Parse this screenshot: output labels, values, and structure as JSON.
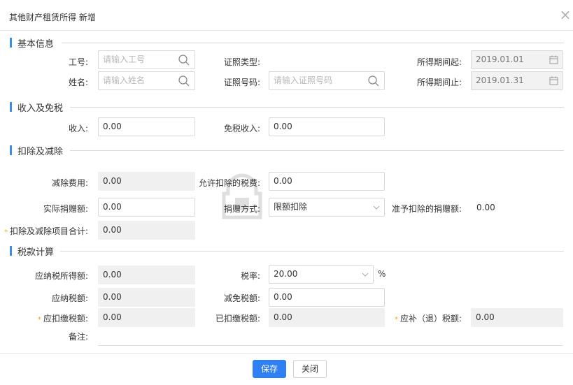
{
  "dialog": {
    "title": "其他财产租赁所得 新增",
    "close_glyph": "×"
  },
  "sections": {
    "basic": "基本信息",
    "income": "收入及免税",
    "deduction": "扣除及减除",
    "tax": "税款计算"
  },
  "basic": {
    "employee_id_label": "工号:",
    "employee_id_placeholder": "请输入工号",
    "id_type_label": "证照类型:",
    "period_start_label": "所得期间起:",
    "period_start_value": "2019.01.01",
    "name_label": "姓名:",
    "name_placeholder": "请输入姓名",
    "id_number_label": "证照号码:",
    "id_number_placeholder": "请输入证照号码",
    "period_end_label": "所得期间止:",
    "period_end_value": "2019.01.31"
  },
  "income": {
    "income_label": "收入:",
    "income_value": "0.00",
    "exempt_label": "免税收入:",
    "exempt_value": "0.00"
  },
  "deduction": {
    "reduce_fee_label": "减除费用:",
    "reduce_fee_value": "0.00",
    "allowed_tax_label": "允许扣除的税费:",
    "allowed_tax_value": "0.00",
    "donation_label": "实际捐赠额:",
    "donation_value": "0.00",
    "donation_method_label": "捐赠方式:",
    "donation_method_value": "限额扣除",
    "approved_donation_label": "准予扣除的捐赠额:",
    "approved_donation_value": "0.00",
    "total_label": "扣除及减除项目合计:",
    "total_value": "0.00"
  },
  "tax": {
    "taxable_income_label": "应纳税所得额:",
    "taxable_income_value": "0.00",
    "rate_label": "税率:",
    "rate_value": "20.00",
    "rate_unit": "%",
    "payable_label": "应纳税额:",
    "payable_value": "0.00",
    "relief_label": "减免税额:",
    "relief_value": "0.00",
    "withhold_label": "应扣缴税额:",
    "withhold_value": "0.00",
    "paid_label": "已扣缴税额:",
    "paid_value": "0.00",
    "refund_label": "应补（退）税额:",
    "refund_value": "0.00",
    "remark_label": "备注:"
  },
  "footer": {
    "save_label": "保存",
    "close_label": "关闭"
  },
  "required_mark": "*",
  "colors": {
    "accent": "#2f7ff5",
    "section_bar": "#3a8ee6",
    "required": "#f5a623"
  }
}
